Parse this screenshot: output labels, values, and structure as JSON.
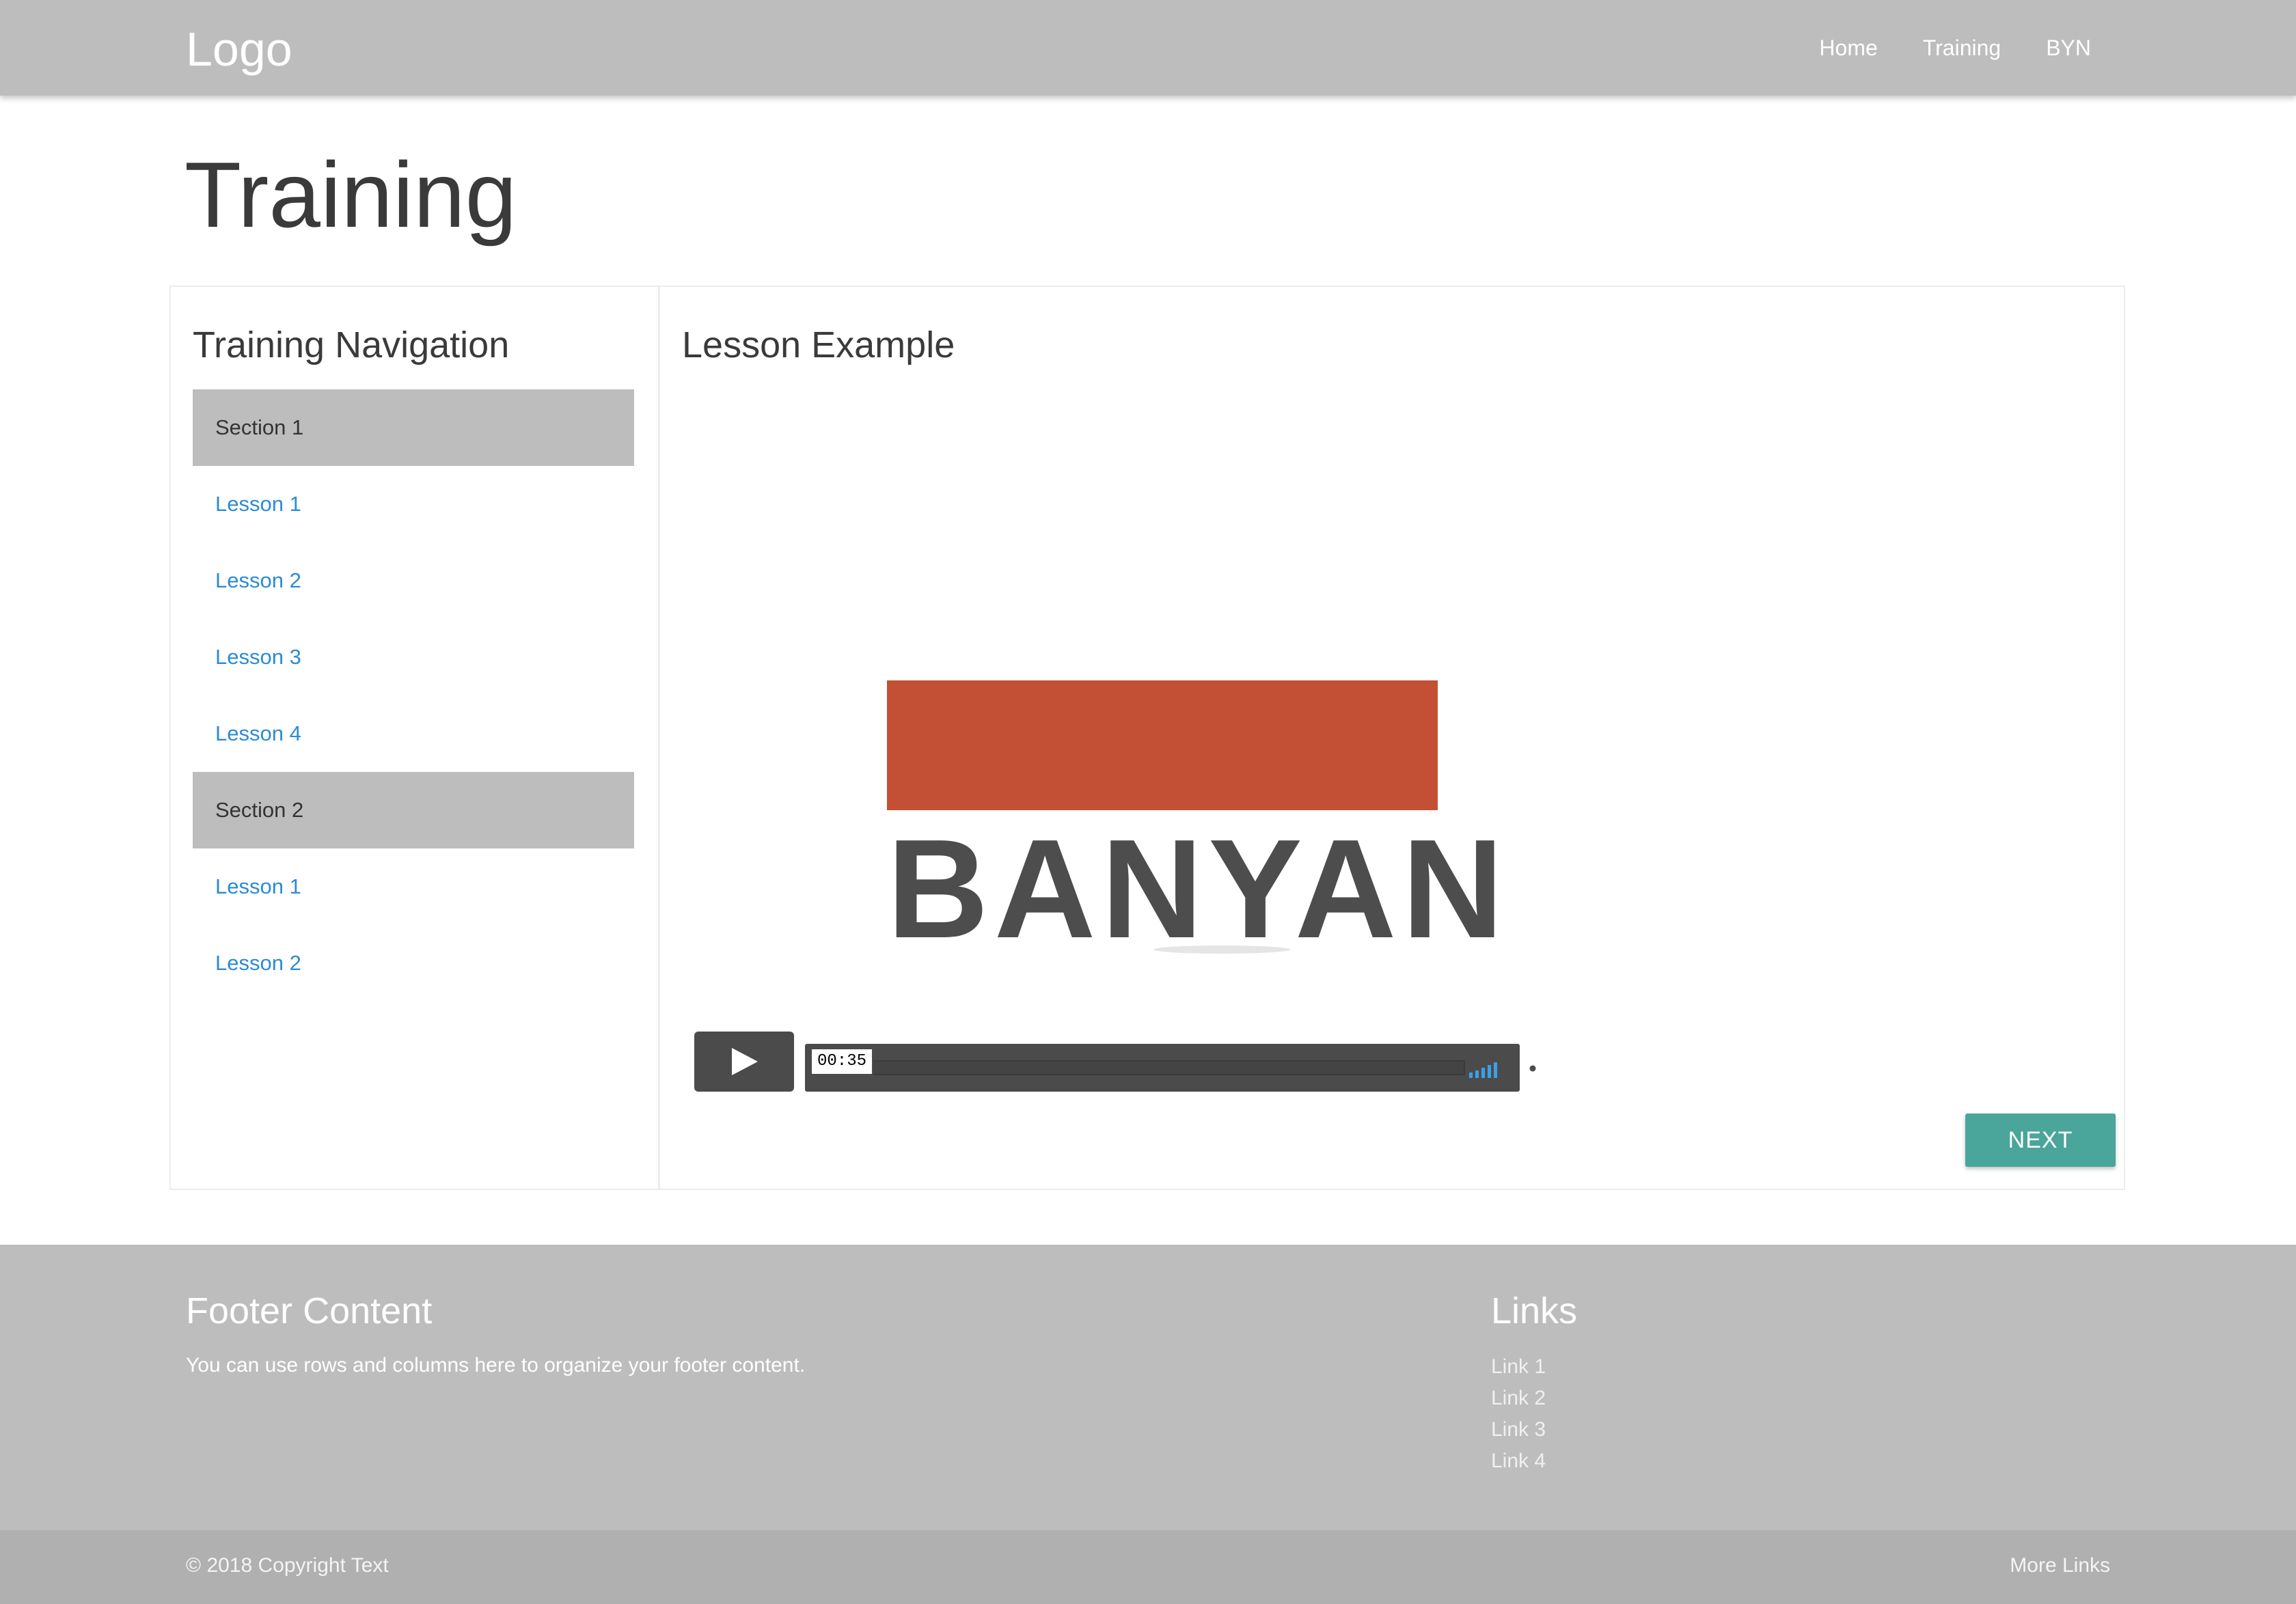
{
  "header": {
    "logo": "Logo",
    "nav": [
      "Home",
      "Training",
      "BYN"
    ]
  },
  "page": {
    "title": "Training"
  },
  "sidebar": {
    "title": "Training Navigation",
    "items": [
      {
        "label": "Section 1",
        "type": "section"
      },
      {
        "label": "Lesson 1",
        "type": "lesson"
      },
      {
        "label": "Lesson 2",
        "type": "lesson"
      },
      {
        "label": "Lesson 3",
        "type": "lesson"
      },
      {
        "label": "Lesson 4",
        "type": "lesson"
      },
      {
        "label": "Section 2",
        "type": "section"
      },
      {
        "label": "Lesson 1",
        "type": "lesson"
      },
      {
        "label": "Lesson 2",
        "type": "lesson"
      }
    ]
  },
  "lesson": {
    "title": "Lesson Example",
    "video": {
      "brand_word": "BANYAN",
      "time": "00:35",
      "progress": 0
    },
    "next_label": "NEXT"
  },
  "footer": {
    "title": "Footer Content",
    "text": "You can use rows and columns here to organize your footer content.",
    "links_title": "Links",
    "links": [
      "Link 1",
      "Link 2",
      "Link 3",
      "Link 4"
    ],
    "copyright": "© 2018 Copyright Text",
    "more_links": "More Links"
  },
  "colors": {
    "header_bg": "#bdbdbd",
    "section_bg": "#bdbdbd",
    "lesson_link": "#2b8bd6",
    "brand_bar": "#c35034",
    "brand_text": "#4d4d4d",
    "player_bg": "#4b4b4b",
    "volume": "#3aa0e8",
    "next_button": "#4aa59a",
    "footer_bg": "#bdbdbd",
    "copyright_bg": "#b0b0b0"
  },
  "icons": {
    "play": "play-icon",
    "volume": "volume-icon",
    "settings": "gear-icon",
    "fullscreen": "fullscreen-icon"
  }
}
